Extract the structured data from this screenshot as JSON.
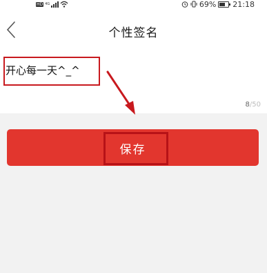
{
  "status_bar": {
    "hd": "HD",
    "network": "4G",
    "battery": "69%",
    "time": "21:18",
    "battery_level": 0.69
  },
  "header": {
    "title": "个性签名"
  },
  "editor": {
    "value": "开心每一天^_^",
    "count_current": "8",
    "count_max": "/50"
  },
  "actions": {
    "save_label": "保存"
  },
  "colors": {
    "accent": "#e2362e",
    "annotation": "#c8191e"
  }
}
